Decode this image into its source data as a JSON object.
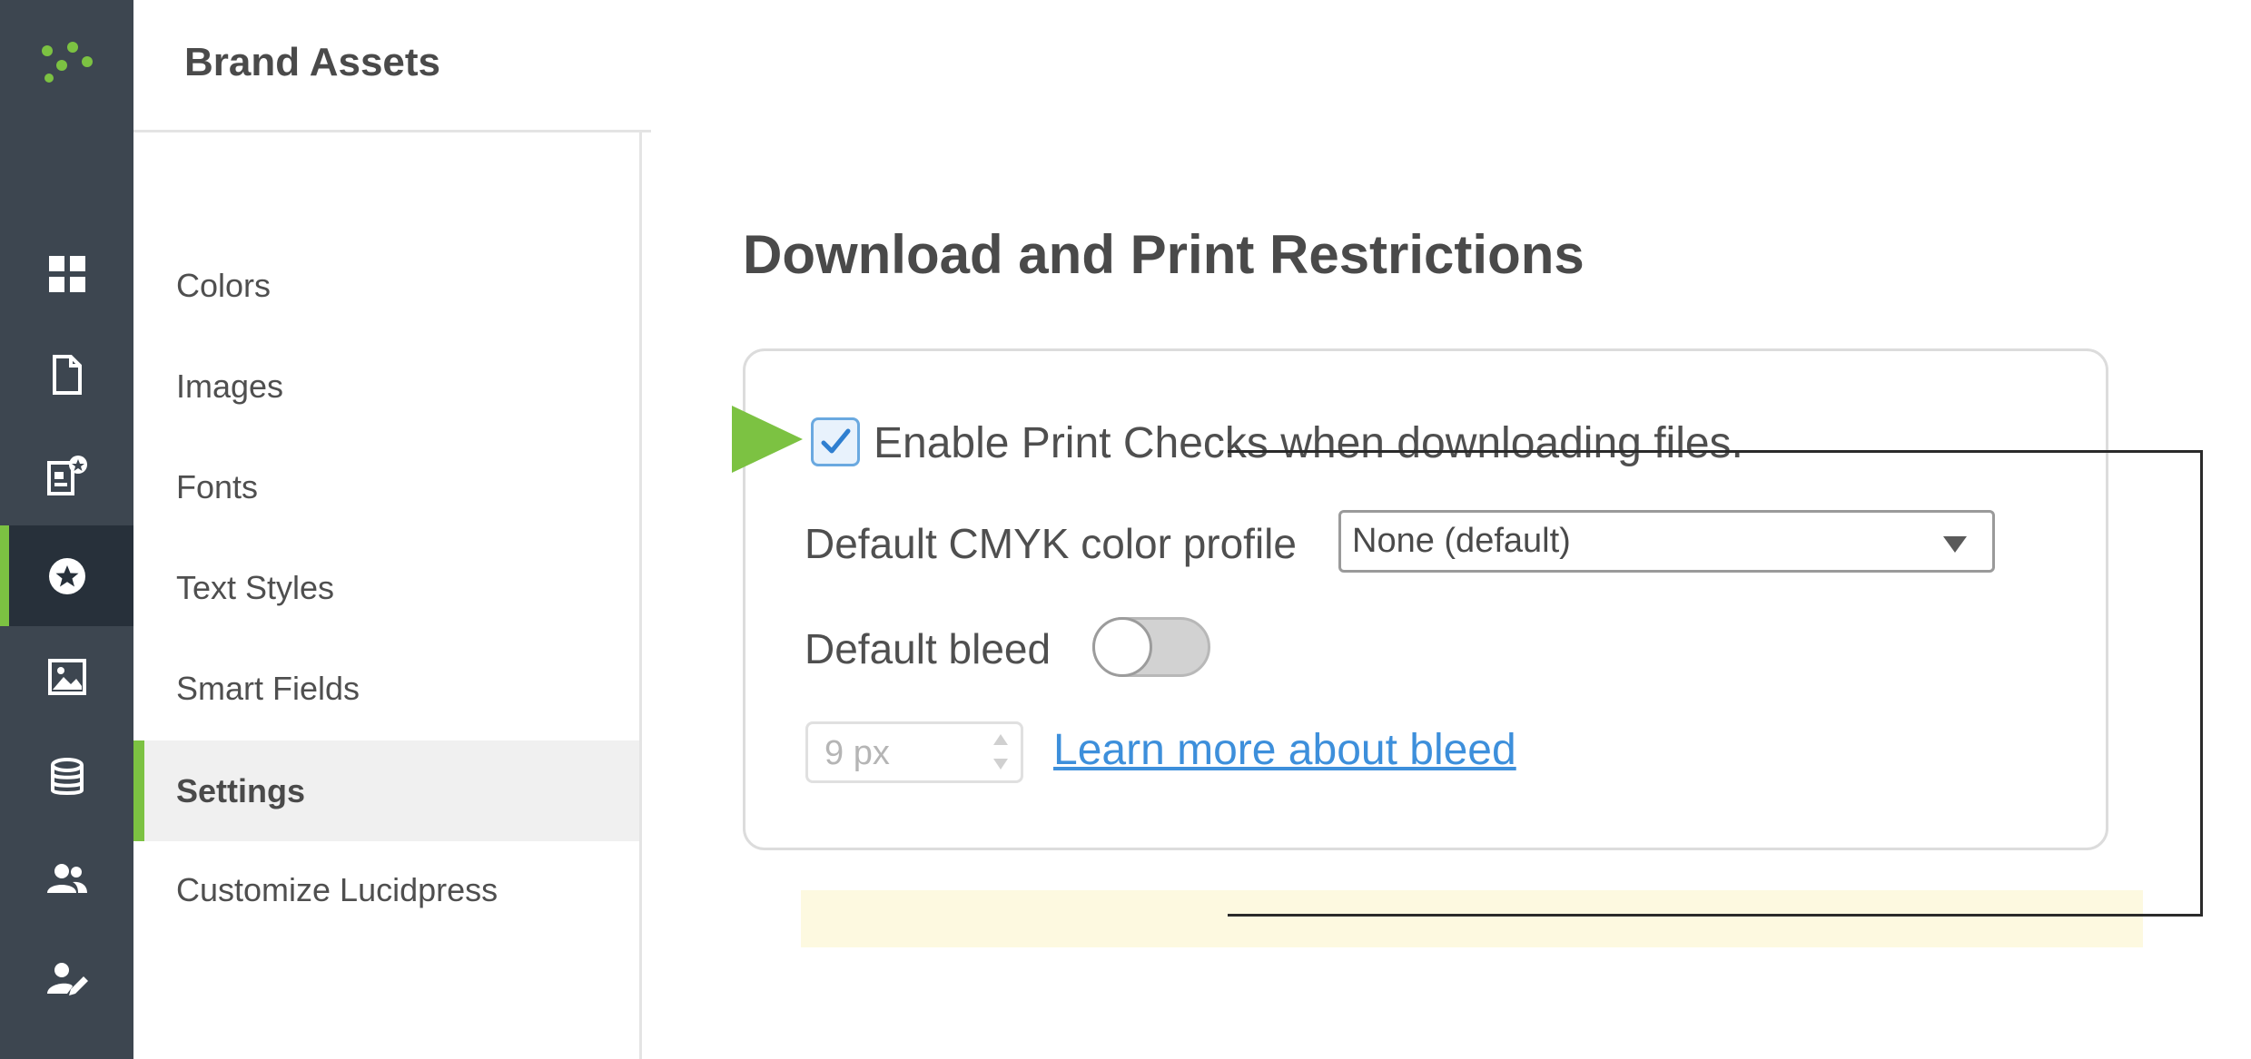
{
  "rail": {
    "logo": "lucid-logo-icon",
    "items": [
      {
        "icon": "dashboard-grid-icon"
      },
      {
        "icon": "document-icon"
      },
      {
        "icon": "template-star-icon"
      },
      {
        "icon": "brand-star-icon",
        "active": true
      },
      {
        "icon": "image-icon"
      },
      {
        "icon": "database-icon"
      },
      {
        "icon": "users-icon"
      },
      {
        "icon": "user-edit-icon"
      }
    ]
  },
  "sidebar": {
    "title": "Brand Assets",
    "items": [
      {
        "label": "Colors"
      },
      {
        "label": "Images"
      },
      {
        "label": "Fonts"
      },
      {
        "label": "Text Styles"
      },
      {
        "label": "Smart Fields"
      },
      {
        "label": "Settings",
        "active": true
      },
      {
        "label": "Customize Lucidpress"
      }
    ]
  },
  "main": {
    "section_title": "Download and Print Restrictions",
    "print_checks": {
      "label": "Enable Print Checks when downloading files.",
      "checked": true
    },
    "cmyk": {
      "label": "Default CMYK color profile",
      "selected": "None (default)"
    },
    "bleed": {
      "label": "Default bleed",
      "enabled": false,
      "placeholder": "9 px"
    },
    "learn_more": "Learn more about bleed"
  },
  "colors": {
    "rail_bg": "#3d4650",
    "accent": "#7cc242",
    "link": "#3d8fdb"
  }
}
